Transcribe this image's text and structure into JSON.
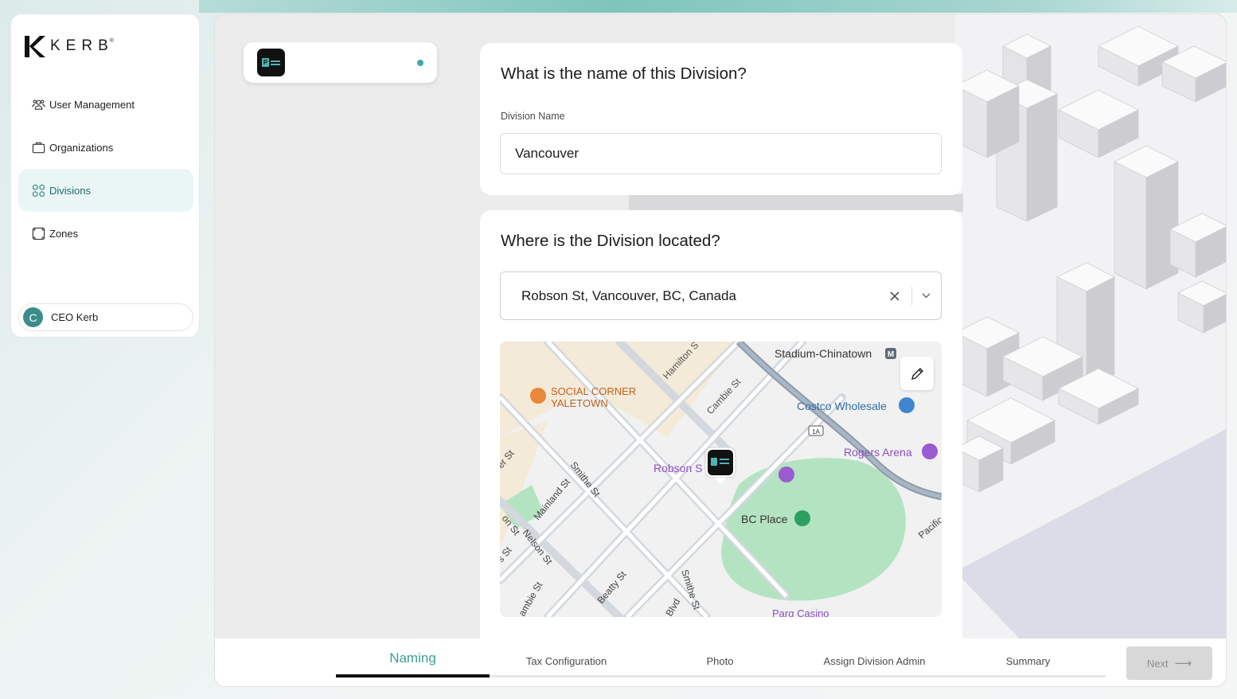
{
  "app": {
    "brand": "KERB",
    "brand_reg": "®"
  },
  "sidebar": {
    "items": [
      {
        "label": "User Management",
        "icon": "users-icon"
      },
      {
        "label": "Organizations",
        "icon": "briefcase-icon"
      },
      {
        "label": "Divisions",
        "icon": "grid-icon",
        "active": true
      },
      {
        "label": "Zones",
        "icon": "zone-icon"
      }
    ],
    "user": {
      "initial": "C",
      "name": "CEO Kerb"
    }
  },
  "form": {
    "name_section": {
      "title": "What is the name of this Division?",
      "field_label": "Division Name",
      "value": "Vancouver"
    },
    "location_section": {
      "title": "Where is the Division located?",
      "value": "Robson St, Vancouver, BC, Canada"
    }
  },
  "map": {
    "labels": {
      "stadium": "Stadium-Chinatown",
      "social": "SOCIAL CORNER",
      "social2": "YALETOWN",
      "hamilton": "Hamilton S",
      "cambie": "Cambie St",
      "costco": "Costco Wholesale",
      "rogers": "Rogers Arena",
      "robson": "Robson S",
      "bcplace": "BC Place",
      "smithe": "Smithe St",
      "mainland": "Mainland St",
      "nelson": "Nelson St",
      "beatty": "Beatty St",
      "smithe2": "Smithe St",
      "pacific": "Pacific",
      "parq": "Parq Casino",
      "hwy": "1A",
      "erst": "er St",
      "onst": "on St",
      "sst": "s St",
      "ambie": "ambie St",
      "blvd": "Blvd"
    }
  },
  "stepper": {
    "steps": [
      "Naming",
      "Tax Configuration",
      "Photo",
      "Assign Division Admin",
      "Summary"
    ],
    "active_index": 0,
    "next_label": "Next",
    "next_arrow": "⟶"
  },
  "colors": {
    "accent": "#3a9c97",
    "park": "#b4e3c1",
    "road": "#d6dbe0",
    "highway": "#8d9aaa"
  }
}
